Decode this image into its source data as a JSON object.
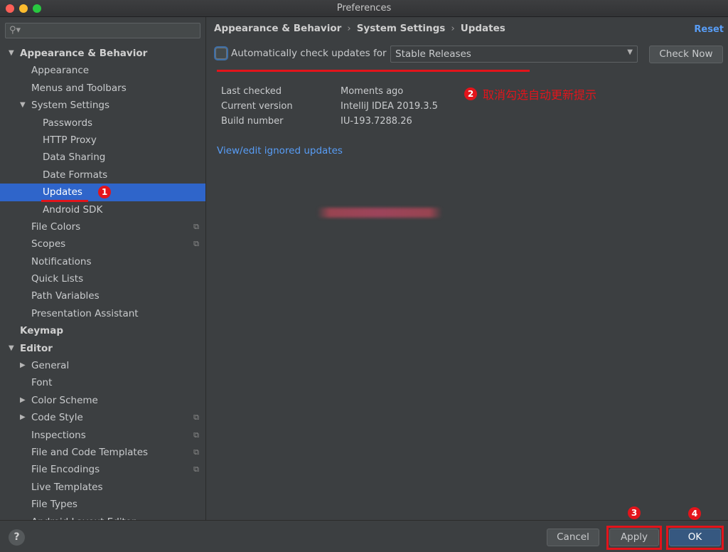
{
  "window": {
    "title": "Preferences"
  },
  "sidebar": {
    "search_placeholder": "",
    "items": [
      {
        "label": "Appearance & Behavior",
        "level": 0,
        "bold": true,
        "arrow": "▼"
      },
      {
        "label": "Appearance",
        "level": 1
      },
      {
        "label": "Menus and Toolbars",
        "level": 1
      },
      {
        "label": "System Settings",
        "level": 1,
        "arrow": "▼"
      },
      {
        "label": "Passwords",
        "level": 2
      },
      {
        "label": "HTTP Proxy",
        "level": 2
      },
      {
        "label": "Data Sharing",
        "level": 2
      },
      {
        "label": "Date Formats",
        "level": 2
      },
      {
        "label": "Updates",
        "level": 2,
        "selected": true,
        "badge": "1"
      },
      {
        "label": "Android SDK",
        "level": 2
      },
      {
        "label": "File Colors",
        "level": 1,
        "copy": true
      },
      {
        "label": "Scopes",
        "level": 1,
        "copy": true
      },
      {
        "label": "Notifications",
        "level": 1
      },
      {
        "label": "Quick Lists",
        "level": 1
      },
      {
        "label": "Path Variables",
        "level": 1
      },
      {
        "label": "Presentation Assistant",
        "level": 1
      },
      {
        "label": "Keymap",
        "level": 0,
        "bold": true
      },
      {
        "label": "Editor",
        "level": 0,
        "bold": true,
        "arrow": "▼"
      },
      {
        "label": "General",
        "level": 1,
        "arrow": "▶"
      },
      {
        "label": "Font",
        "level": 1
      },
      {
        "label": "Color Scheme",
        "level": 1,
        "arrow": "▶"
      },
      {
        "label": "Code Style",
        "level": 1,
        "arrow": "▶",
        "copy": true
      },
      {
        "label": "Inspections",
        "level": 1,
        "copy": true
      },
      {
        "label": "File and Code Templates",
        "level": 1,
        "copy": true
      },
      {
        "label": "File Encodings",
        "level": 1,
        "copy": true
      },
      {
        "label": "Live Templates",
        "level": 1
      },
      {
        "label": "File Types",
        "level": 1
      },
      {
        "label": "Android Layout Editor",
        "level": 1
      }
    ]
  },
  "main": {
    "breadcrumb": [
      "Appearance & Behavior",
      "System Settings",
      "Updates"
    ],
    "breadcrumb_sep": "›",
    "reset_label": "Reset",
    "auto_check_label": "Automatically check updates for",
    "auto_check_checked": false,
    "channel_value": "Stable Releases",
    "check_now_label": "Check Now",
    "info": [
      {
        "key": "Last checked",
        "value": "Moments ago"
      },
      {
        "key": "Current version",
        "value": "IntelliJ IDEA 2019.3.5"
      },
      {
        "key": "Build number",
        "value": "IU-193.7288.26"
      }
    ],
    "ignored_link": "View/edit ignored updates",
    "annotation": {
      "badge": "2",
      "text": "取消勾选自动更新提示"
    }
  },
  "footer": {
    "help_label": "?",
    "cancel_label": "Cancel",
    "apply_label": "Apply",
    "ok_label": "OK",
    "apply_badge": "3",
    "ok_badge": "4"
  },
  "colors": {
    "annotation_red": "#e3141b",
    "selection_blue": "#2f65ca",
    "link_blue": "#589df6",
    "background": "#3c3f41"
  }
}
